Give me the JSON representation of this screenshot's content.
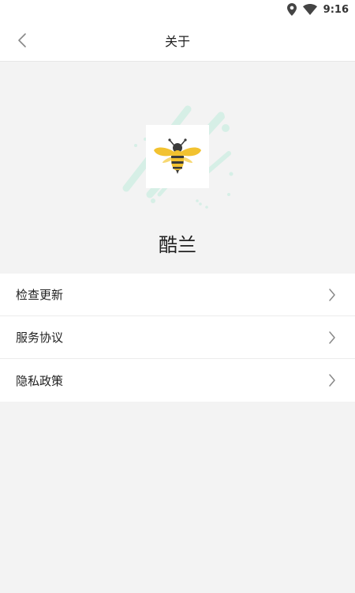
{
  "status_bar": {
    "time": "9:16",
    "icons": [
      "location-icon",
      "wifi-icon"
    ]
  },
  "header": {
    "title": "关于",
    "back_icon": "chevron-left-icon"
  },
  "app": {
    "name": "酷兰",
    "logo_icon": "bee-icon"
  },
  "menu": {
    "items": [
      {
        "label": "检查更新",
        "icon": "chevron-right-icon"
      },
      {
        "label": "服务协议",
        "icon": "chevron-right-icon"
      },
      {
        "label": "隐私政策",
        "icon": "chevron-right-icon"
      }
    ]
  },
  "colors": {
    "background": "#f3f3f3",
    "surface": "#ffffff",
    "accent_mint": "#d6efe6",
    "bee_yellow": "#f2c230",
    "bee_dark": "#3b3b3b"
  }
}
